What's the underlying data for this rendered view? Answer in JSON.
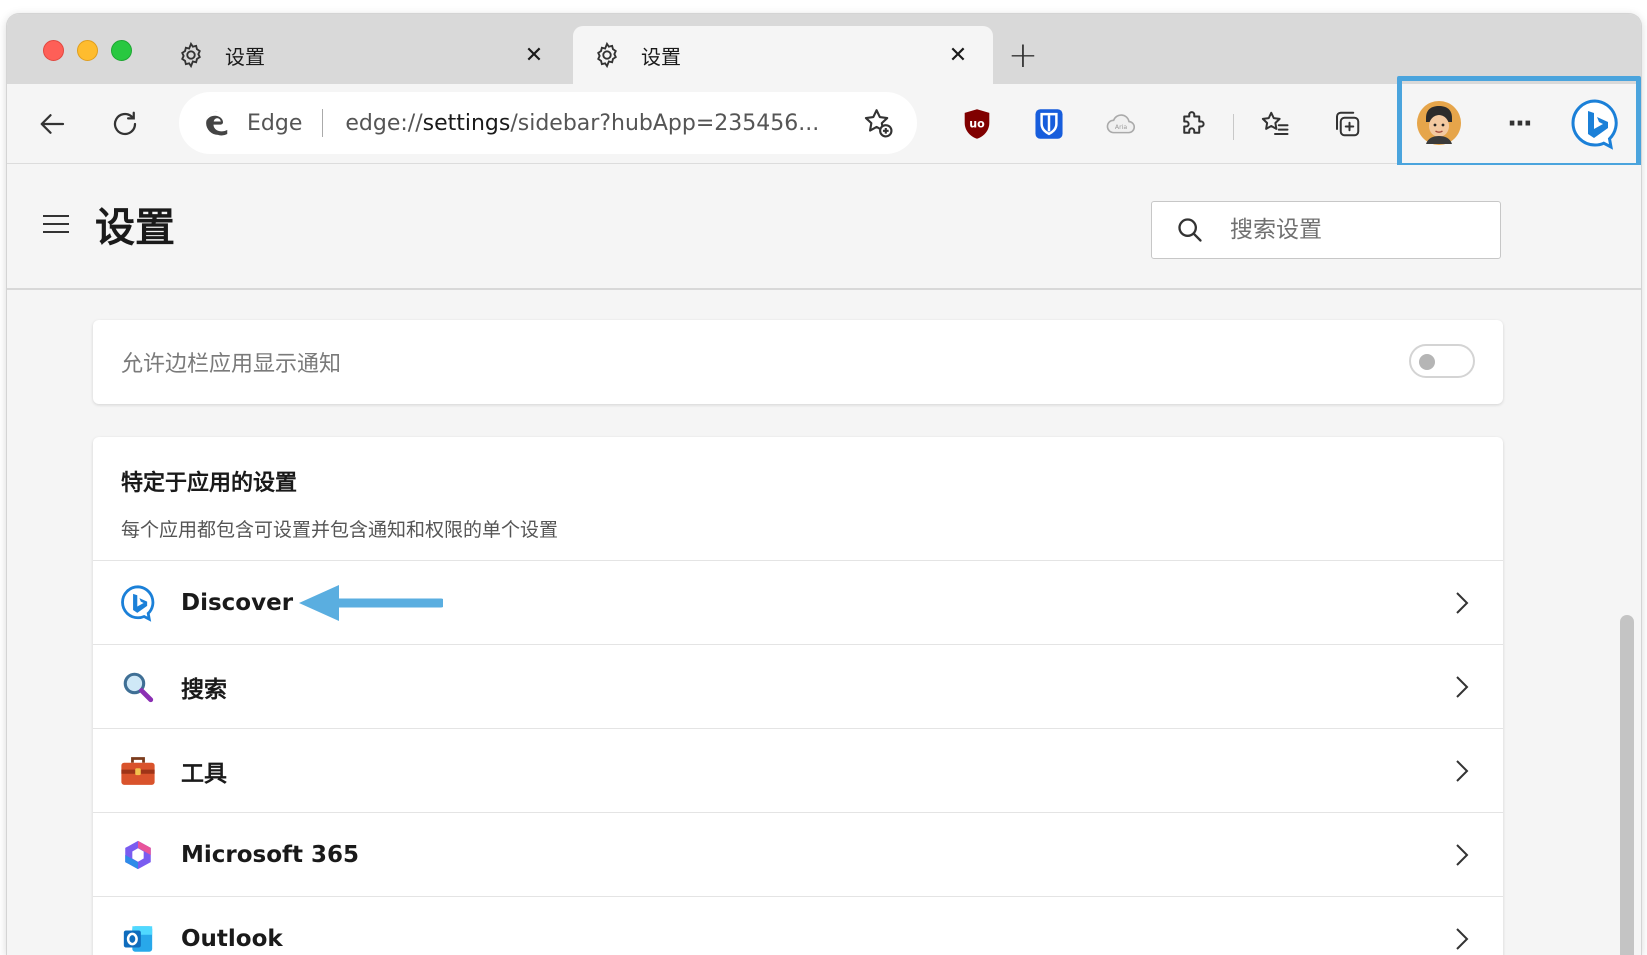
{
  "tabs": [
    {
      "title": "设置",
      "active": false,
      "icon": "gear-icon"
    },
    {
      "title": "设置",
      "active": true,
      "icon": "gear-icon"
    }
  ],
  "tab_close_glyph": "✕",
  "new_tab_glyph": "+",
  "addressbar": {
    "brand": "Edge",
    "url_prefix": "edge://",
    "url_host": "settings",
    "url_rest": "/sidebar?hubApp=235456..."
  },
  "toolbar_icons": [
    "back-icon",
    "refresh-icon",
    "ublock-icon",
    "bitwarden-icon",
    "cloud-icon",
    "extensions-icon",
    "favorites-icon",
    "collections-icon",
    "profile-avatar",
    "more-icon",
    "bing-icon"
  ],
  "more_glyph": "···",
  "page": {
    "title": "设置",
    "search_placeholder": "搜索设置"
  },
  "notify_card": {
    "label": "允许边栏应用显示通知",
    "toggle_on": false
  },
  "apps_card": {
    "title": "特定于应用的设置",
    "description": "每个应用都包含可设置并包含通知和权限的单个设置",
    "apps": [
      {
        "name": "Discover",
        "icon": "bing-discover-icon"
      },
      {
        "name": "搜索",
        "icon": "magnifier-icon"
      },
      {
        "name": "工具",
        "icon": "toolbox-icon"
      },
      {
        "name": "Microsoft 365",
        "icon": "microsoft-365-icon"
      },
      {
        "name": "Outlook",
        "icon": "outlook-icon"
      }
    ]
  },
  "colors": {
    "highlight": "#4aa4dd",
    "annotation_arrow": "#5aaee0",
    "bing_blue": "#1b80d8"
  }
}
